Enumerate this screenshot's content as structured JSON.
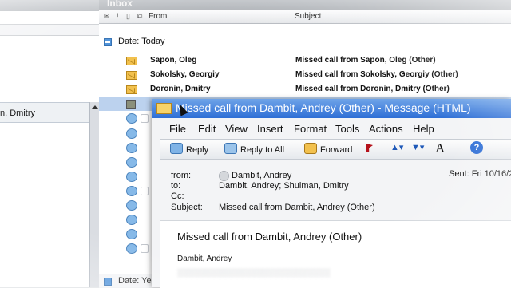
{
  "inbox": {
    "title": "Inbox"
  },
  "left_pane": {
    "selected_item": "n, Dmitry"
  },
  "columns": {
    "from": "From",
    "subject": "Subject"
  },
  "group": {
    "label": "Date: Today"
  },
  "messages": [
    {
      "from": "Sapon, Oleg",
      "subject": "Missed call from Sapon, Oleg (Other)"
    },
    {
      "from": "Sokolsky, Georgiy",
      "subject": "Missed call from Sokolsky, Georgiy (Other)"
    },
    {
      "from": "Doronin, Dmitry",
      "subject": "Missed call from Doronin, Dmitry (Other)"
    }
  ],
  "bottom_group": {
    "label": "Date: Ye"
  },
  "message_window": {
    "title": "Missed call from Dambit, Andrey (Other) - Message (HTML)",
    "menu": [
      "File",
      "Edit",
      "View",
      "Insert",
      "Format",
      "Tools",
      "Actions",
      "Help"
    ],
    "toolbar": {
      "reply": "Reply",
      "reply_all": "Reply to All",
      "forward": "Forward",
      "font": "A",
      "help": "?"
    },
    "headers": {
      "from_label": "from:",
      "from_value": "Dambit, Andrey",
      "to_label": "to:",
      "to_value": "Dambit, Andrey; Shulman, Dmitry",
      "cc_label": "Cc:",
      "cc_value": "",
      "subject_label": "Subject:",
      "subject_value": "Missed call from Dambit, Andrey (Other)",
      "sent": "Sent: Fri 10/16/2"
    },
    "body": {
      "subject": "Missed call from Dambit, Andrey (Other)",
      "name": "Dambit, Andrey"
    }
  }
}
